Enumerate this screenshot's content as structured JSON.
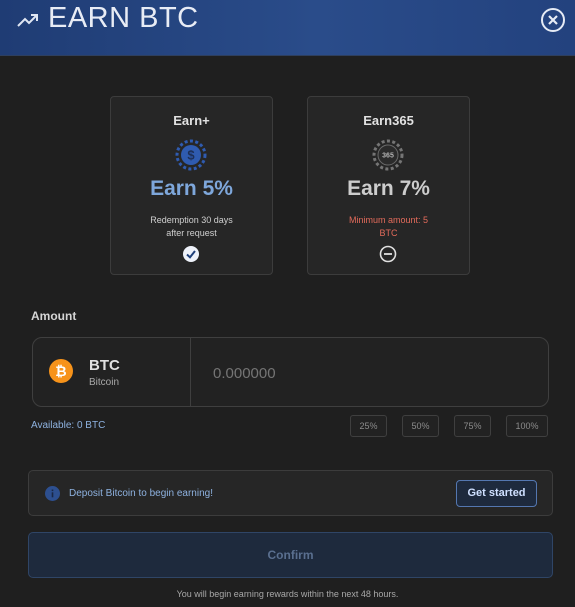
{
  "header": {
    "title": "EARN BTC",
    "trend_icon": "trending-up-icon",
    "close_icon": "close-icon"
  },
  "plans": [
    {
      "name": "Earn+",
      "icon": "dollar-coin-icon",
      "rate_label": "Earn 5%",
      "description_lines": [
        "Redemption 30 days",
        "after request"
      ],
      "state_icon": "check-circle-icon",
      "selected": true
    },
    {
      "name": "Earn365",
      "icon": "365-coin-icon",
      "icon_text": "365",
      "rate_label": "Earn 7%",
      "description_lines": [
        "Minimum amount: 5",
        "BTC"
      ],
      "state_icon": "minus-circle-icon",
      "selected": false
    }
  ],
  "amount": {
    "label": "Amount",
    "coin_ticker": "BTC",
    "coin_name": "Bitcoin",
    "coin_icon": "bitcoin-icon",
    "placeholder": "0.000000",
    "value": "",
    "available": "Available: 0 BTC",
    "percent_buttons": [
      "25%",
      "50%",
      "75%",
      "100%"
    ]
  },
  "deposit": {
    "message": "Deposit Bitcoin to begin earning!",
    "button": "Get started",
    "icon": "info-icon"
  },
  "confirm_label": "Confirm",
  "footnote": "You will begin earning rewards within the next 48 hours.",
  "colors": {
    "accent": "#7ea7db",
    "warning": "#e36b5b",
    "bitcoin": "#f7931a",
    "header": "#24437f"
  }
}
